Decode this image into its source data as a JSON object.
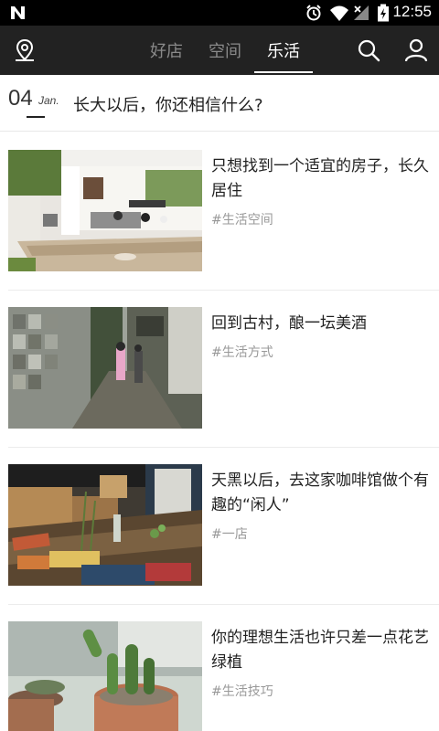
{
  "status_bar": {
    "time": "12:55"
  },
  "nav": {
    "tabs": [
      {
        "label": "好店",
        "active": false
      },
      {
        "label": "空间",
        "active": false
      },
      {
        "label": "乐活",
        "active": true
      }
    ],
    "icons": {
      "left": "location-icon",
      "search": "search-icon",
      "profile": "user-icon"
    }
  },
  "date_header": {
    "day": "04",
    "month": "Jan.",
    "title": "长大以后，你还相信什么?"
  },
  "articles": [
    {
      "title": "只想找到一个适宜的房子，长久居住",
      "tag": "#生活空间"
    },
    {
      "title": "回到古村，酿一坛美酒",
      "tag": "#生活方式"
    },
    {
      "title": "天黑以后，去这家咖啡馆做个有趣的“闲人”",
      "tag": "#一店"
    },
    {
      "title": "你的理想生活也许只差一点花艺绿植",
      "tag": "#生活技巧"
    }
  ],
  "colors": {
    "app_bar": "#222222",
    "tab_inactive": "#8a8a8a",
    "tag": "#999999"
  }
}
